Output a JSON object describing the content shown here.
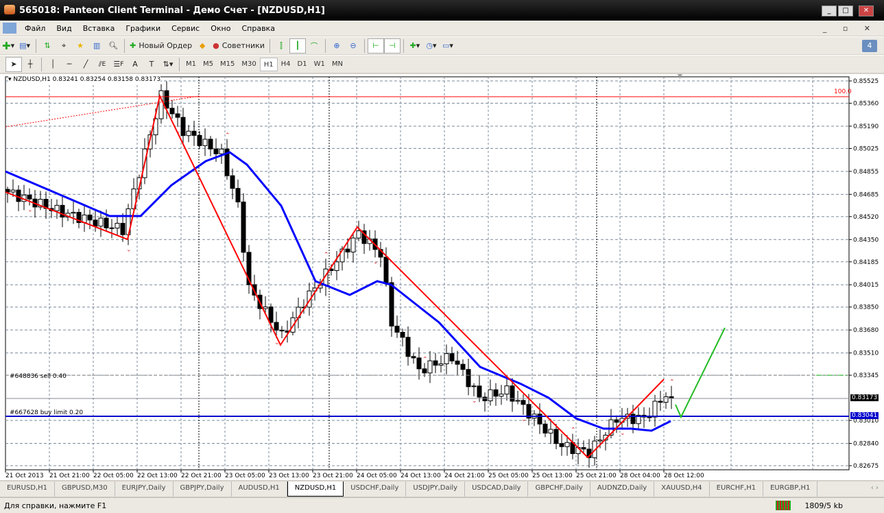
{
  "window": {
    "title": "565018: Panteon Client Terminal - Демо Счет - [NZDUSD,H1]",
    "min": "_",
    "max": "□",
    "close": "✕"
  },
  "menu": [
    "Файл",
    "Вид",
    "Вставка",
    "Графики",
    "Сервис",
    "Окно",
    "Справка"
  ],
  "toolbar": {
    "new_order": "Новый Ордер",
    "experts": "Советники",
    "badge": "4"
  },
  "drawing_tools": {
    "text_tool": "A",
    "fibo_e": "E",
    "fibo_f": "F",
    "label_tool": "T"
  },
  "timeframes": [
    "M1",
    "M5",
    "M15",
    "M30",
    "H1",
    "H4",
    "D1",
    "W1",
    "MN"
  ],
  "active_timeframe": "H1",
  "chart": {
    "header": "NZDUSD,H1  0.83241 0.83254 0.83158 0.83173",
    "price_labels": [
      "0.85525",
      "0.85360",
      "0.85190",
      "0.85025",
      "0.84855",
      "0.84685",
      "0.84520",
      "0.84350",
      "0.84185",
      "0.84015",
      "0.83850",
      "0.83680",
      "0.83510",
      "0.83345",
      "0.83010",
      "0.82840",
      "0.82675"
    ],
    "time_labels": [
      "21 Oct 2013",
      "21 Oct 21:00",
      "22 Oct 05:00",
      "22 Oct 13:00",
      "22 Oct 21:00",
      "23 Oct 05:00",
      "23 Oct 13:00",
      "23 Oct 21:00",
      "24 Oct 05:00",
      "24 Oct 13:00",
      "24 Oct 21:00",
      "25 Oct 05:00",
      "25 Oct 13:00",
      "25 Oct 21:00",
      "28 Oct 04:00",
      "28 Oct 12:00"
    ],
    "current_price": "0.83173",
    "order_price": "0.83041",
    "sell_order": "#648836 sell 0.40",
    "buy_limit": "#667628 buy limit 0.20",
    "fibo_level": "100.0",
    "price_range": [
      0.82675,
      0.85525
    ],
    "close_anchors": [
      [
        0,
        0.84702
      ],
      [
        10,
        0.8455
      ],
      [
        21,
        0.84423
      ],
      [
        28,
        0.85413
      ],
      [
        32,
        0.85159
      ],
      [
        39,
        0.84981
      ],
      [
        42,
        0.846
      ],
      [
        44,
        0.83991
      ],
      [
        50,
        0.83635
      ],
      [
        54,
        0.83889
      ],
      [
        64,
        0.84397
      ],
      [
        68,
        0.84245
      ],
      [
        70,
        0.83737
      ],
      [
        75,
        0.83381
      ],
      [
        81,
        0.83483
      ],
      [
        86,
        0.83178
      ],
      [
        91,
        0.83229
      ],
      [
        96,
        0.83026
      ],
      [
        101,
        0.82823
      ],
      [
        106,
        0.82772
      ],
      [
        111,
        0.83026
      ],
      [
        116,
        0.83026
      ],
      [
        120,
        0.83204
      ],
      [
        121,
        0.83173
      ]
    ],
    "colors": {
      "zigzag": "#ff0000",
      "ma": "#0000ff",
      "projection": "#22bb22",
      "grid": "#7a8899"
    }
  },
  "tabs": [
    "EURUSD,H1",
    "GBPUSD,M30",
    "EURJPY,Daily",
    "GBPJPY,Daily",
    "AUDUSD,H1",
    "NZDUSD,H1",
    "USDCHF,Daily",
    "USDJPY,Daily",
    "USDCAD,Daily",
    "GBPCHF,Daily",
    "AUDNZD,Daily",
    "XAUUSD,H4",
    "EURCHF,H1",
    "EURGBP,H1"
  ],
  "active_tab": "NZDUSD,H1",
  "status": {
    "help": "Для справки, нажмите F1",
    "traffic": "1809/5 kb"
  }
}
